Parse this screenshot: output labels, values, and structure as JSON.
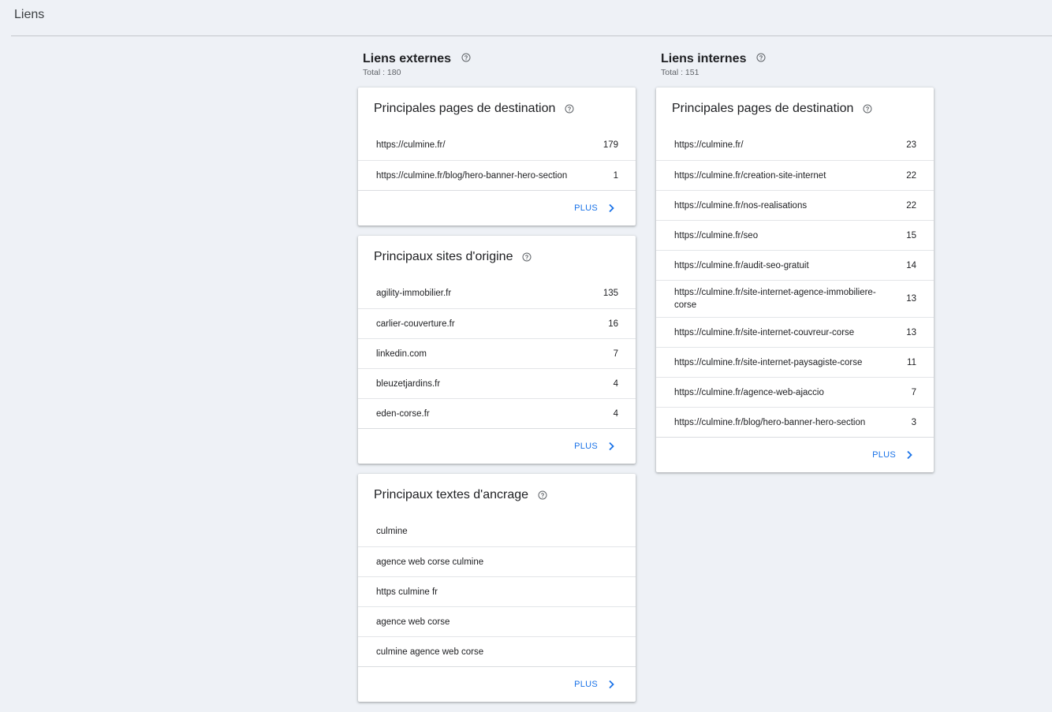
{
  "page": {
    "title": "Liens"
  },
  "colors": {
    "accent": "#1a73e8",
    "background": "#eef1f6"
  },
  "external": {
    "title": "Liens externes",
    "total": "Total : 180",
    "top_pages": {
      "title": "Principales pages de destination",
      "rows": [
        {
          "label": "https://culmine.fr/",
          "value": "179"
        },
        {
          "label": "https://culmine.fr/blog/hero-banner-hero-section",
          "value": "1"
        }
      ],
      "more": "PLUS"
    },
    "top_sites": {
      "title": "Principaux sites d'origine",
      "rows": [
        {
          "label": "agility-immobilier.fr",
          "value": "135"
        },
        {
          "label": "carlier-couverture.fr",
          "value": "16"
        },
        {
          "label": "linkedin.com",
          "value": "7"
        },
        {
          "label": "bleuzetjardins.fr",
          "value": "4"
        },
        {
          "label": "eden-corse.fr",
          "value": "4"
        }
      ],
      "more": "PLUS"
    },
    "top_anchors": {
      "title": "Principaux textes d'ancrage",
      "rows": [
        {
          "label": "culmine"
        },
        {
          "label": "agence web corse culmine"
        },
        {
          "label": "https culmine fr"
        },
        {
          "label": "agence web corse"
        },
        {
          "label": "culmine agence web corse"
        }
      ],
      "more": "PLUS"
    }
  },
  "internal": {
    "title": "Liens internes",
    "total": "Total : 151",
    "top_pages": {
      "title": "Principales pages de destination",
      "rows": [
        {
          "label": "https://culmine.fr/",
          "value": "23"
        },
        {
          "label": "https://culmine.fr/creation-site-internet",
          "value": "22"
        },
        {
          "label": "https://culmine.fr/nos-realisations",
          "value": "22"
        },
        {
          "label": "https://culmine.fr/seo",
          "value": "15"
        },
        {
          "label": "https://culmine.fr/audit-seo-gratuit",
          "value": "14"
        },
        {
          "label": "https://culmine.fr/site-internet-agence-immobiliere-corse",
          "value": "13"
        },
        {
          "label": "https://culmine.fr/site-internet-couvreur-corse",
          "value": "13"
        },
        {
          "label": "https://culmine.fr/site-internet-paysagiste-corse",
          "value": "11"
        },
        {
          "label": "https://culmine.fr/agence-web-ajaccio",
          "value": "7"
        },
        {
          "label": "https://culmine.fr/blog/hero-banner-hero-section",
          "value": "3"
        }
      ],
      "more": "PLUS"
    }
  },
  "icons": {
    "help": "help-circle-icon",
    "chevron": "chevron-right-icon"
  }
}
